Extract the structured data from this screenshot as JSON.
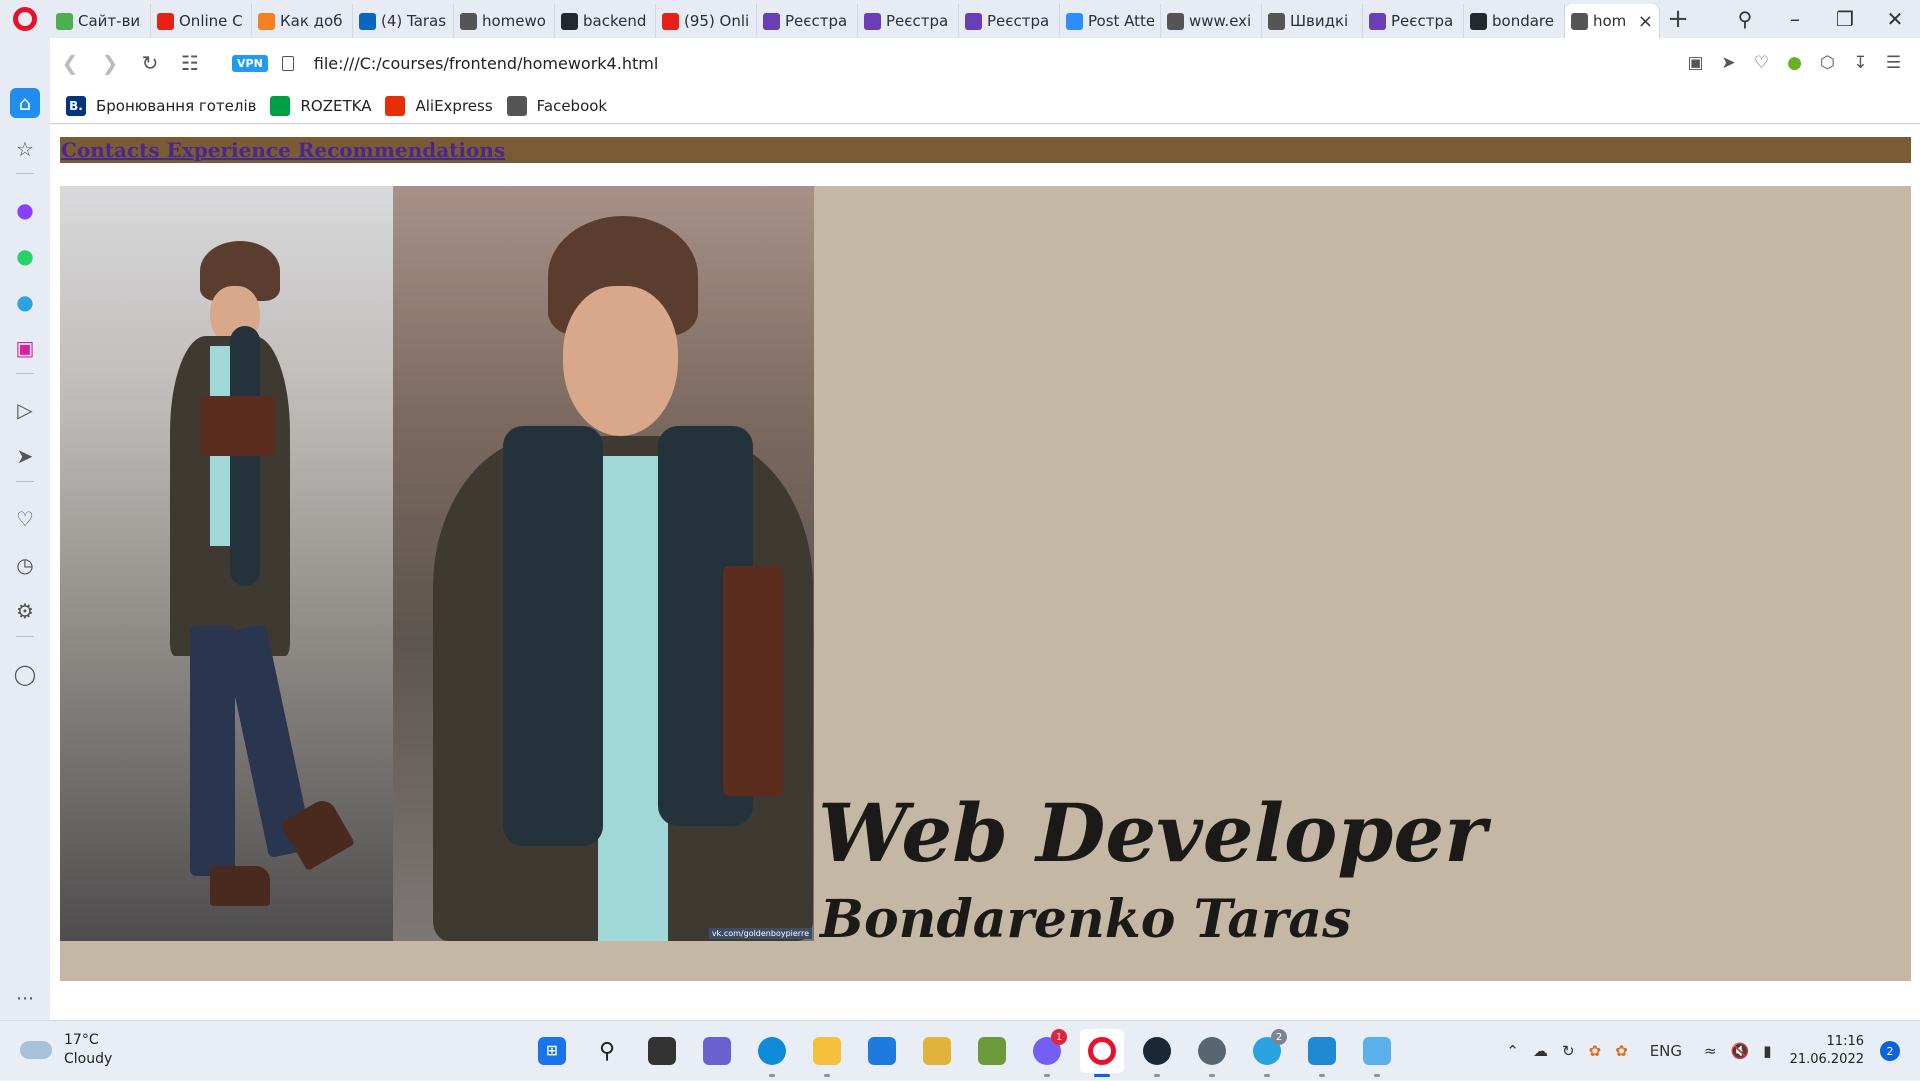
{
  "browser": {
    "tabs": [
      {
        "label": "Сайт-ви",
        "icon": "green-leaf-icon",
        "color": "#4caf50"
      },
      {
        "label": "Online C",
        "icon": "youtube-icon",
        "color": "#e62117"
      },
      {
        "label": "Как доб",
        "icon": "code-icon",
        "color": "#f48024"
      },
      {
        "label": "(4) Taras",
        "icon": "linkedin-icon",
        "color": "#0a66c2"
      },
      {
        "label": "homewo",
        "icon": "globe-icon",
        "color": "#555555"
      },
      {
        "label": "backend",
        "icon": "github-icon",
        "color": "#24292f"
      },
      {
        "label": "(95) Onli",
        "icon": "youtube-icon",
        "color": "#e62117"
      },
      {
        "label": "Реєстра",
        "icon": "forms-icon",
        "color": "#6a3fb5"
      },
      {
        "label": "Реєстра",
        "icon": "forms-icon",
        "color": "#6a3fb5"
      },
      {
        "label": "Реєстра",
        "icon": "forms-icon",
        "color": "#6a3fb5"
      },
      {
        "label": "Post Atte",
        "icon": "zoom-icon",
        "color": "#2d8cff"
      },
      {
        "label": "www.exi",
        "icon": "globe-icon",
        "color": "#555555"
      },
      {
        "label": "Швидкі",
        "icon": "grid-icon",
        "color": "#555555"
      },
      {
        "label": "Реєстра",
        "icon": "forms-icon",
        "color": "#6a3fb5"
      },
      {
        "label": "bondare",
        "icon": "github-icon",
        "color": "#24292f"
      },
      {
        "label": "hom",
        "icon": "globe-icon",
        "color": "#555555",
        "active": true
      }
    ],
    "address": "file:///C:/courses/frontend/homework4.html",
    "vpn_label": "VPN",
    "bookmarks": [
      {
        "label": "Бронювання готелів",
        "icon_text": "B.",
        "color": "#003580"
      },
      {
        "label": "ROZETKA",
        "icon_text": "",
        "color": "#00a046"
      },
      {
        "label": "AliExpress",
        "icon_text": "",
        "color": "#e62e04"
      },
      {
        "label": "Facebook",
        "icon_text": "",
        "color": "#555555"
      }
    ]
  },
  "page": {
    "nav_links": "Contacts  Experience  Recommendations",
    "title": "Web Developer",
    "name": "Bondarenko Taras",
    "watermark": "vk.com/goldenboypierre",
    "colors": {
      "nav_bg": "#7a5c34",
      "hero_bg": "#c4b8a4",
      "link": "#4a2690"
    }
  },
  "taskbar": {
    "temperature": "17°C",
    "condition": "Cloudy",
    "language": "ENG",
    "time": "11:16",
    "date": "21.06.2022",
    "notifications": "2",
    "viber_badge": "1",
    "telegram_badge": "2"
  }
}
